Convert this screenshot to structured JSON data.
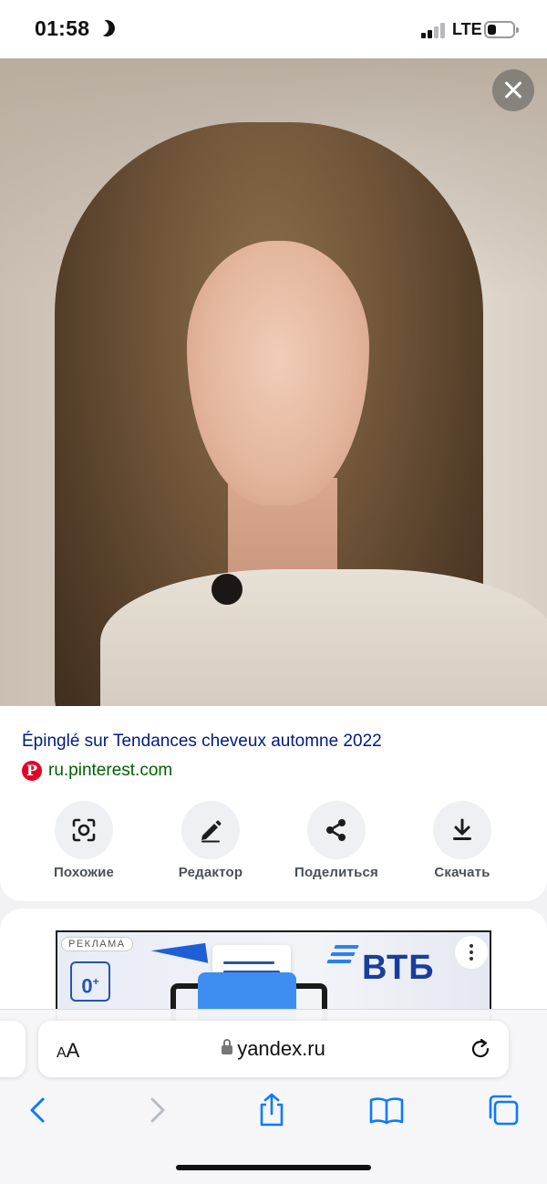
{
  "status_bar": {
    "time": "01:58",
    "network": "LTE",
    "battery_level": 0.35,
    "signal_bars_active": 2,
    "signal_bars_total": 4
  },
  "viewer": {
    "image_subject": "portrait of a woman with long layered brown hair",
    "close_icon": "close-icon"
  },
  "result": {
    "title": "Épinglé sur Tendances cheveux automne 2022",
    "source_icon": "pinterest-icon",
    "source_domain": "ru.pinterest.com",
    "title_color": "#001a80",
    "source_color": "#006000"
  },
  "actions": [
    {
      "label": "Похожие",
      "icon": "lens-scan-icon"
    },
    {
      "label": "Редактор",
      "icon": "pencil-icon"
    },
    {
      "label": "Поделиться",
      "icon": "share-icon"
    },
    {
      "label": "Скачать",
      "icon": "download-icon"
    }
  ],
  "ad": {
    "badge": "РЕКЛАМА",
    "age_rating": "0",
    "age_rating_suffix": "+",
    "brand": "ВТБ",
    "menu_icon": "more-vertical-icon"
  },
  "browser": {
    "text_size_label_small": "A",
    "text_size_label_large": "A",
    "url": "yandex.ru",
    "lock_icon": "lock-icon",
    "reload_icon": "reload-icon",
    "toolbar": [
      "back-icon",
      "forward-icon",
      "share-icon",
      "bookmarks-icon",
      "tabs-icon"
    ],
    "accent_color": "#0a7aff"
  }
}
